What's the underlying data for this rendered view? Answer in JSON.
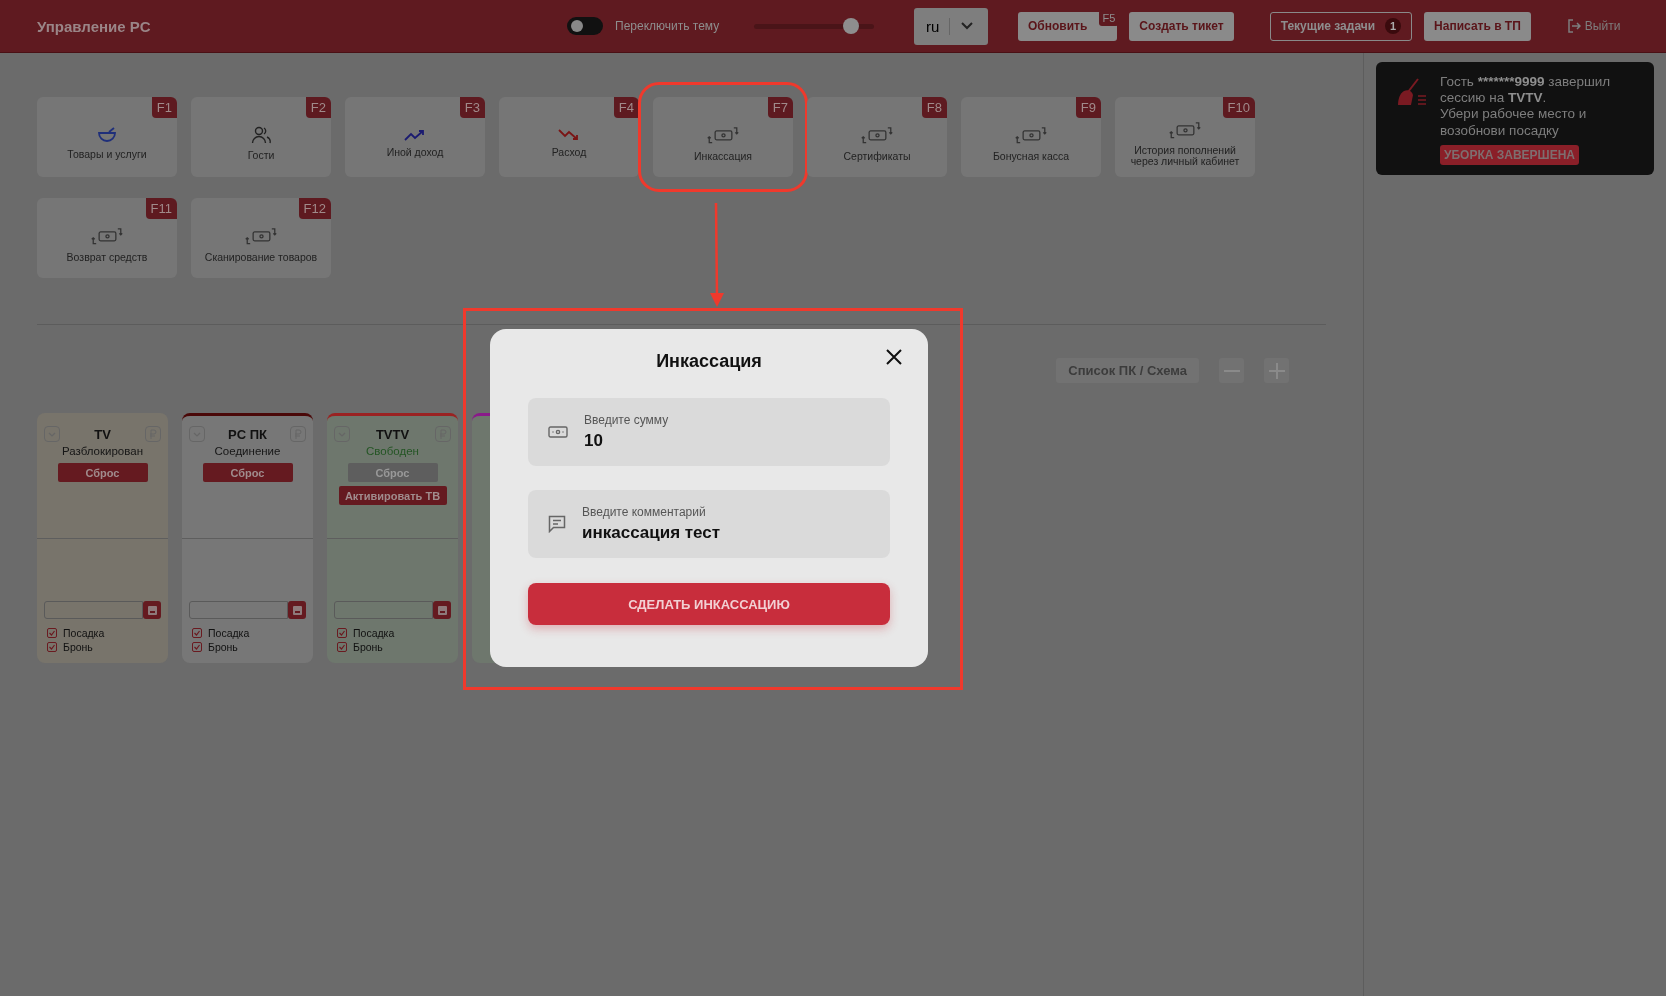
{
  "header": {
    "title": "Управление PC",
    "theme_toggle": {
      "on": false,
      "label": "Переключить тему"
    },
    "slider": {
      "level": 0.83
    },
    "language": {
      "value": "ru"
    },
    "buttons": [
      {
        "label": "Обновить",
        "kind": "filled",
        "hotkey": "F5"
      },
      {
        "label": "Создать тикет",
        "kind": "filled"
      },
      {
        "label": "Текущие задачи",
        "kind": "outline",
        "count": "1"
      },
      {
        "label": "Написать в ТП",
        "kind": "filled"
      },
      {
        "label": "Выйти",
        "kind": "link"
      }
    ]
  },
  "tiles": [
    {
      "label": "Товары и услуги",
      "hotkey": "F1",
      "kind": "bowl",
      "annotated": false
    },
    {
      "label": "Гости",
      "hotkey": "F2",
      "kind": "people",
      "annotated": false
    },
    {
      "label": "Иной доход",
      "hotkey": "F3",
      "kind": "income",
      "annotated": false
    },
    {
      "label": "Расход",
      "hotkey": "F4",
      "kind": "expense",
      "annotated": false
    },
    {
      "label": "Инкассация",
      "hotkey": "F7",
      "kind": "money",
      "annotated": true
    },
    {
      "label": "Сертификаты",
      "hotkey": "F8",
      "kind": "money",
      "annotated": false
    },
    {
      "label": "Бонусная касса",
      "hotkey": "F9",
      "kind": "money",
      "annotated": false
    },
    {
      "label": "История пополнений через личный кабинет",
      "hotkey": "F10",
      "kind": "money",
      "annotated": false
    },
    {
      "label": "Возврат средств",
      "hotkey": "F11",
      "kind": "money",
      "annotated": false
    },
    {
      "label": "Сканирование товаров",
      "hotkey": "F12",
      "kind": "money",
      "annotated": false
    }
  ],
  "toolbar": {
    "view_toggle": "Список ПК / Схема"
  },
  "cards": [
    {
      "name": "TV",
      "status": "Разблокирован",
      "free": false,
      "buttons": [
        {
          "label": "Сброс",
          "enabled": true
        }
      ],
      "checkboxes": [
        {
          "label": "Посадка",
          "checked": true
        },
        {
          "label": "Бронь",
          "checked": true
        }
      ]
    },
    {
      "name": "PC ПК",
      "status": "Соединение",
      "free": false,
      "buttons": [
        {
          "label": "Сброс",
          "enabled": true
        }
      ],
      "checkboxes": [
        {
          "label": "Посадка",
          "checked": true
        },
        {
          "label": "Бронь",
          "checked": true
        }
      ]
    },
    {
      "name": "TVTV",
      "status": "Свободен",
      "free": true,
      "buttons": [
        {
          "label": "Сброс",
          "enabled": false
        },
        {
          "label": "Активировать ТВ",
          "enabled": true
        }
      ],
      "checkboxes": [
        {
          "label": "Посадка",
          "checked": true
        },
        {
          "label": "Бронь",
          "checked": true
        }
      ]
    }
  ],
  "notification": {
    "segments": [
      {
        "text": "Гость ",
        "bold": false
      },
      {
        "text": "*******9999",
        "bold": true
      },
      {
        "text": " завершил сессию на ",
        "bold": false
      },
      {
        "text": "TVTV",
        "bold": true
      },
      {
        "text": ".",
        "bold": false
      }
    ],
    "hint": "Убери рабочее место и возобнови посадку",
    "action": "УБОРКА ЗАВЕРШЕНА"
  },
  "modal": {
    "title": "Инкассация",
    "annotated": true,
    "fields": [
      {
        "label": "Введите сумму",
        "value": "10",
        "kind": "money"
      },
      {
        "label": "Введите комментарий",
        "value": "инкассация тест",
        "kind": "comment"
      }
    ],
    "submit": "СДЕЛАТЬ ИНКАССАЦИЮ"
  }
}
